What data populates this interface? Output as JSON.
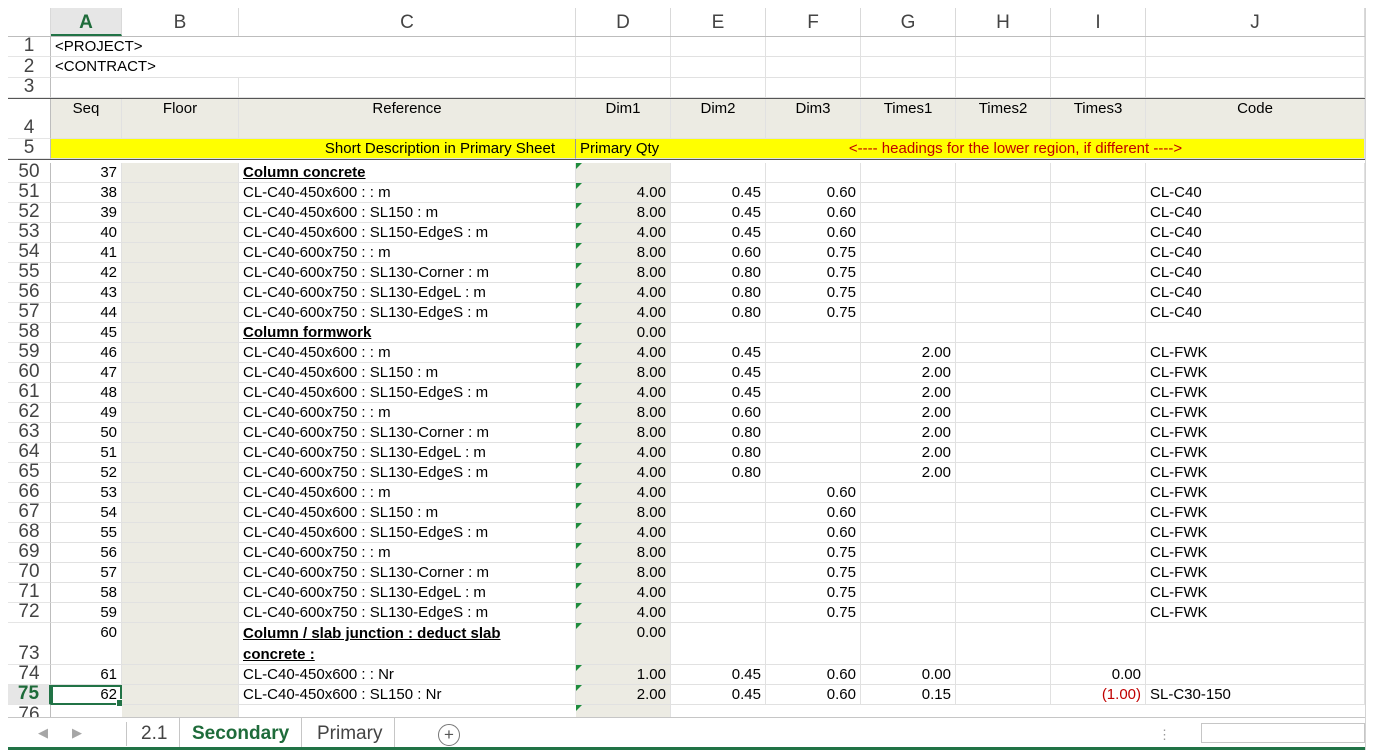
{
  "columns": [
    "A",
    "B",
    "C",
    "D",
    "E",
    "F",
    "G",
    "H",
    "I",
    "J"
  ],
  "selected_column": "A",
  "rows": {
    "r1": {
      "n": "1",
      "a": "<PROJECT>"
    },
    "r2": {
      "n": "2",
      "a": "<CONTRACT>"
    },
    "r3": {
      "n": "3"
    },
    "r4": {
      "n": "4",
      "a": "Seq",
      "b": "Floor",
      "c": "Reference",
      "d": "Dim1",
      "e": "Dim2",
      "f": "Dim3",
      "g": "Times1",
      "h": "Times2",
      "i": "Times3",
      "j": "Code"
    },
    "r5": {
      "n": "5",
      "c": "Short Description in Primary Sheet",
      "d": "Primary Qty",
      "g": "<---- headings for the lower region, if different ---->"
    }
  },
  "data_rows": [
    {
      "n": "50",
      "a": "37",
      "c": "Column concrete",
      "bold": true,
      "d": "",
      "e": "",
      "f": "",
      "g": "",
      "i": "",
      "j": ""
    },
    {
      "n": "51",
      "a": "38",
      "c": "CL-C40-450x600 :  : m",
      "d": "4.00",
      "e": "0.45",
      "f": "0.60",
      "g": "",
      "i": "",
      "j": "CL-C40"
    },
    {
      "n": "52",
      "a": "39",
      "c": "CL-C40-450x600 : SL150 : m",
      "d": "8.00",
      "e": "0.45",
      "f": "0.60",
      "g": "",
      "i": "",
      "j": "CL-C40"
    },
    {
      "n": "53",
      "a": "40",
      "c": "CL-C40-450x600 : SL150-EdgeS : m",
      "d": "4.00",
      "e": "0.45",
      "f": "0.60",
      "g": "",
      "i": "",
      "j": "CL-C40"
    },
    {
      "n": "54",
      "a": "41",
      "c": "CL-C40-600x750 :  : m",
      "d": "8.00",
      "e": "0.60",
      "f": "0.75",
      "g": "",
      "i": "",
      "j": "CL-C40"
    },
    {
      "n": "55",
      "a": "42",
      "c": "CL-C40-600x750 : SL130-Corner : m",
      "d": "8.00",
      "e": "0.80",
      "f": "0.75",
      "g": "",
      "i": "",
      "j": "CL-C40"
    },
    {
      "n": "56",
      "a": "43",
      "c": "CL-C40-600x750 : SL130-EdgeL : m",
      "d": "4.00",
      "e": "0.80",
      "f": "0.75",
      "g": "",
      "i": "",
      "j": "CL-C40"
    },
    {
      "n": "57",
      "a": "44",
      "c": "CL-C40-600x750 : SL130-EdgeS : m",
      "d": "4.00",
      "e": "0.80",
      "f": "0.75",
      "g": "",
      "i": "",
      "j": "CL-C40"
    },
    {
      "n": "58",
      "a": "45",
      "c": "Column formwork",
      "bold": true,
      "d": "0.00",
      "e": "",
      "f": "",
      "g": "",
      "i": "",
      "j": ""
    },
    {
      "n": "59",
      "a": "46",
      "c": "CL-C40-450x600 :  : m",
      "d": "4.00",
      "e": "0.45",
      "f": "",
      "g": "2.00",
      "i": "",
      "j": "CL-FWK"
    },
    {
      "n": "60",
      "a": "47",
      "c": "CL-C40-450x600 : SL150 : m",
      "d": "8.00",
      "e": "0.45",
      "f": "",
      "g": "2.00",
      "i": "",
      "j": "CL-FWK"
    },
    {
      "n": "61",
      "a": "48",
      "c": "CL-C40-450x600 : SL150-EdgeS : m",
      "d": "4.00",
      "e": "0.45",
      "f": "",
      "g": "2.00",
      "i": "",
      "j": "CL-FWK"
    },
    {
      "n": "62",
      "a": "49",
      "c": "CL-C40-600x750 :  : m",
      "d": "8.00",
      "e": "0.60",
      "f": "",
      "g": "2.00",
      "i": "",
      "j": "CL-FWK"
    },
    {
      "n": "63",
      "a": "50",
      "c": "CL-C40-600x750 : SL130-Corner : m",
      "d": "8.00",
      "e": "0.80",
      "f": "",
      "g": "2.00",
      "i": "",
      "j": "CL-FWK"
    },
    {
      "n": "64",
      "a": "51",
      "c": "CL-C40-600x750 : SL130-EdgeL : m",
      "d": "4.00",
      "e": "0.80",
      "f": "",
      "g": "2.00",
      "i": "",
      "j": "CL-FWK"
    },
    {
      "n": "65",
      "a": "52",
      "c": "CL-C40-600x750 : SL130-EdgeS : m",
      "d": "4.00",
      "e": "0.80",
      "f": "",
      "g": "2.00",
      "i": "",
      "j": "CL-FWK"
    },
    {
      "n": "66",
      "a": "53",
      "c": "CL-C40-450x600 :  : m",
      "d": "4.00",
      "e": "",
      "f": "0.60",
      "g": "",
      "i": "",
      "j": "CL-FWK"
    },
    {
      "n": "67",
      "a": "54",
      "c": "CL-C40-450x600 : SL150 : m",
      "d": "8.00",
      "e": "",
      "f": "0.60",
      "g": "",
      "i": "",
      "j": "CL-FWK"
    },
    {
      "n": "68",
      "a": "55",
      "c": "CL-C40-450x600 : SL150-EdgeS : m",
      "d": "4.00",
      "e": "",
      "f": "0.60",
      "g": "",
      "i": "",
      "j": "CL-FWK"
    },
    {
      "n": "69",
      "a": "56",
      "c": "CL-C40-600x750 :  : m",
      "d": "8.00",
      "e": "",
      "f": "0.75",
      "g": "",
      "i": "",
      "j": "CL-FWK"
    },
    {
      "n": "70",
      "a": "57",
      "c": "CL-C40-600x750 : SL130-Corner : m",
      "d": "8.00",
      "e": "",
      "f": "0.75",
      "g": "",
      "i": "",
      "j": "CL-FWK"
    },
    {
      "n": "71",
      "a": "58",
      "c": "CL-C40-600x750 : SL130-EdgeL : m",
      "d": "4.00",
      "e": "",
      "f": "0.75",
      "g": "",
      "i": "",
      "j": "CL-FWK"
    },
    {
      "n": "72",
      "a": "59",
      "c": "CL-C40-600x750 : SL130-EdgeS : m",
      "d": "4.00",
      "e": "",
      "f": "0.75",
      "g": "",
      "i": "",
      "j": "CL-FWK"
    }
  ],
  "row73": {
    "n": "73",
    "a": "60",
    "c1": "Column / slab junction : deduct slab",
    "c2": "concrete :",
    "d": "0.00"
  },
  "row74": {
    "n": "74",
    "a": "61",
    "c": "CL-C40-450x600 :  : Nr",
    "d": "1.00",
    "e": "0.45",
    "f": "0.60",
    "g": "0.00",
    "i": "0.00",
    "j": ""
  },
  "row75": {
    "n": "75",
    "a": "62",
    "c": "CL-C40-450x600 : SL150 : Nr",
    "d": "2.00",
    "e": "0.45",
    "f": "0.60",
    "g": "0.15",
    "i": "(1.00)",
    "j": "SL-C30-150"
  },
  "row76": {
    "n": "76"
  },
  "tabs": {
    "prev": "◀",
    "next": "▶",
    "t1": "2.1",
    "t2": "Secondary",
    "t3": "Primary",
    "add": "+",
    "active": "Secondary"
  },
  "colors": {
    "accent": "#217346",
    "yellow": "#ffff00",
    "red_text": "#c00000",
    "shade": "#ecebe3"
  }
}
